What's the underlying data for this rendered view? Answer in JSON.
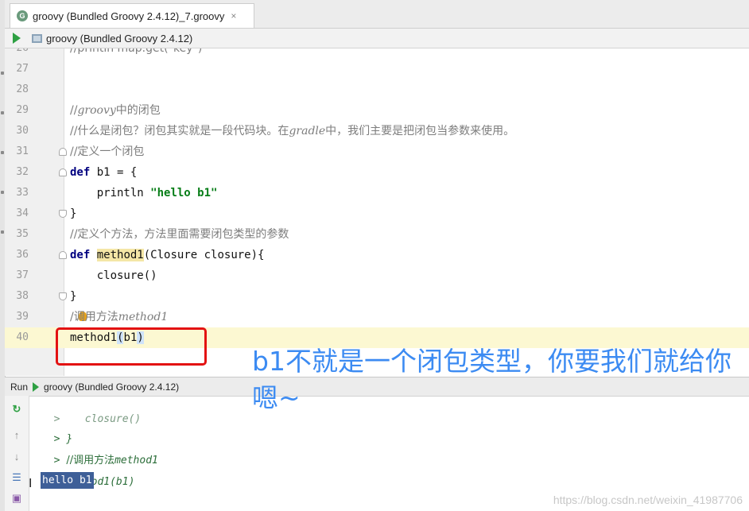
{
  "tab": {
    "icon_letter": "G",
    "title": "groovy (Bundled Groovy 2.4.12)_7.groovy",
    "close": "×"
  },
  "runbar": {
    "config": "groovy (Bundled Groovy 2.4.12)"
  },
  "editor": {
    "partial_top": "//println map.get(\"key\")",
    "lines": [
      {
        "n": "27"
      },
      {
        "n": "28"
      },
      {
        "n": "29",
        "cmt_a": "//",
        "cmt_i": "groovy",
        "cmt_b": "中的闭包"
      },
      {
        "n": "30",
        "cmt_a": "//什么是闭包？闭包其实就是一段代码块。在",
        "cmt_i": "gradle",
        "cmt_b": "中，我们主要是把闭包当参数来使用。"
      },
      {
        "n": "31",
        "text": "//定义一个闭包"
      },
      {
        "n": "32",
        "kw": "def",
        "rest": " b1 = {"
      },
      {
        "n": "33",
        "pre": "    println ",
        "str": "\"hello b1\""
      },
      {
        "n": "34",
        "rest": "}"
      },
      {
        "n": "35",
        "text": "//定义个方法，方法里面需要闭包类型的参数"
      },
      {
        "n": "36",
        "kw": "def",
        "sp": " ",
        "fn": "method1",
        "rest": "(Closure closure){"
      },
      {
        "n": "37",
        "rest": "    closure()"
      },
      {
        "n": "38",
        "rest": "}"
      },
      {
        "n": "39",
        "cmt_a": "/",
        "cmt_b": "调用方法",
        "cmt_i": "method1"
      },
      {
        "n": "40",
        "call": "method1",
        "paren": "(",
        "arg": "b1",
        "close": ")"
      }
    ]
  },
  "annotation": {
    "text": "b1不就是一个闭包类型，你要我们就给你嗯~"
  },
  "run": {
    "label": "Run",
    "config": "groovy (Bundled Groovy 2.4.12)",
    "output": [
      {
        "prefix": ">    ",
        "text": "closure()"
      },
      {
        "prefix": "> ",
        "text": "}"
      },
      {
        "prefix": "> ",
        "cn": "//调用方法",
        "it": "method1"
      },
      {
        "prefix": "> ",
        "it": "method1(b1)"
      }
    ],
    "result": "hello b1"
  },
  "watermark": "https://blog.csdn.net/weixin_41987706",
  "colors": {
    "accent": "#3c8bf2",
    "highlight_box": "#e31212",
    "run_green": "#2ea043"
  }
}
